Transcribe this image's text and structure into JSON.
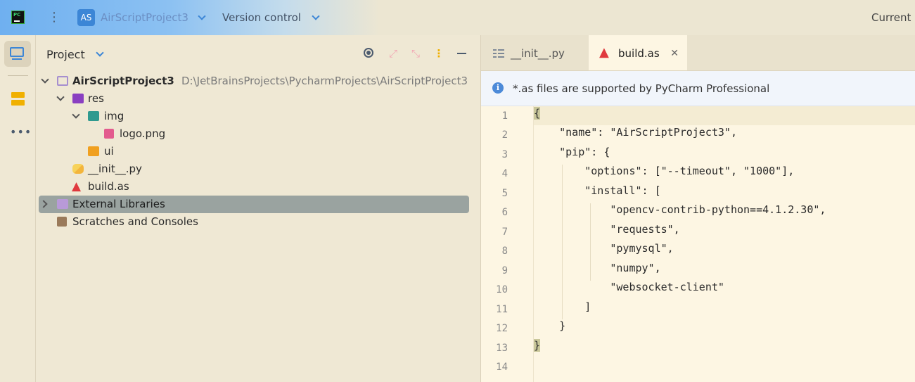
{
  "titlebar": {
    "project_badge": "AS",
    "project_name": "AirScriptProject3",
    "vcs_label": "Version control",
    "run_config": "Current"
  },
  "project_panel": {
    "title": "Project",
    "tree": [
      {
        "label": "AirScriptProject3",
        "path": "D:\\JetBrainsProjects\\PycharmProjects\\AirScriptProject3",
        "icon": "folder-icon"
      },
      {
        "label": "res",
        "icon": "resource-folder-icon"
      },
      {
        "label": "img",
        "icon": "image-folder-icon"
      },
      {
        "label": "logo.png",
        "icon": "image-file-icon"
      },
      {
        "label": "ui",
        "icon": "ui-folder-icon"
      },
      {
        "label": "__init__.py",
        "icon": "python-file-icon"
      },
      {
        "label": "build.as",
        "icon": "as-file-icon"
      },
      {
        "label": "External Libraries",
        "icon": "library-icon"
      },
      {
        "label": "Scratches and Consoles",
        "icon": "scratches-icon"
      }
    ]
  },
  "editor": {
    "tabs": [
      {
        "label": "__init__.py",
        "active": false
      },
      {
        "label": "build.as",
        "active": true
      }
    ],
    "banner": "*.as files are supported by PyCharm Professional",
    "line_numbers": [
      "1",
      "2",
      "3",
      "4",
      "5",
      "6",
      "7",
      "8",
      "9",
      "10",
      "11",
      "12",
      "13",
      "14"
    ],
    "lines": [
      "{",
      "    \"name\": \"AirScriptProject3\",",
      "    \"pip\": {",
      "        \"options\": [\"--timeout\", \"1000\"],",
      "        \"install\": [",
      "            \"opencv-contrib-python==4.1.2.30\",",
      "            \"requests\",",
      "            \"pymysql\",",
      "            \"numpy\",",
      "            \"websocket-client\"",
      "        ]",
      "    }",
      "}",
      ""
    ]
  },
  "colors": {
    "background": "#efe8d4",
    "editor_background": "#fdf6e3",
    "accent": "#3c86d6",
    "selection": "#9aa3a0"
  }
}
